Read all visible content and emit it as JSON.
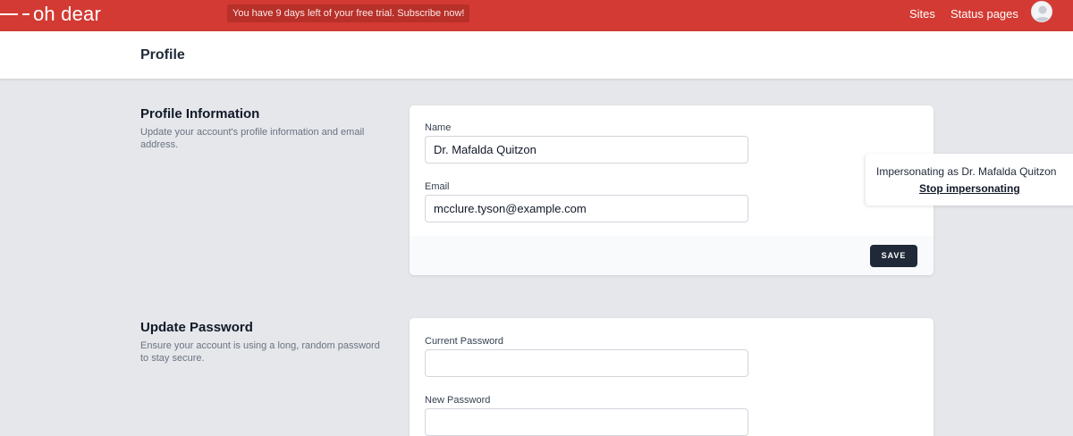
{
  "brand": {
    "name": "oh dear",
    "color": "#d33a33"
  },
  "trial_banner": "You have 9 days left of your free trial. Subscribe now!",
  "nav": {
    "sites": "Sites",
    "status_pages": "Status pages",
    "avatar_icon": "user-avatar-icon"
  },
  "page": {
    "title": "Profile"
  },
  "profile_info": {
    "title": "Profile Information",
    "description": "Update your account's profile information and email address.",
    "name_label": "Name",
    "name_value": "Dr. Mafalda Quitzon",
    "email_label": "Email",
    "email_value": "mcclure.tyson@example.com",
    "save_label": "SAVE"
  },
  "update_password": {
    "title": "Update Password",
    "description": "Ensure your account is using a long, random password to stay secure.",
    "current_label": "Current Password",
    "current_value": "",
    "new_label": "New Password",
    "new_value": ""
  },
  "impersonation": {
    "text": "Impersonating as Dr. Mafalda Quitzon",
    "stop_label": "Stop impersonating"
  }
}
